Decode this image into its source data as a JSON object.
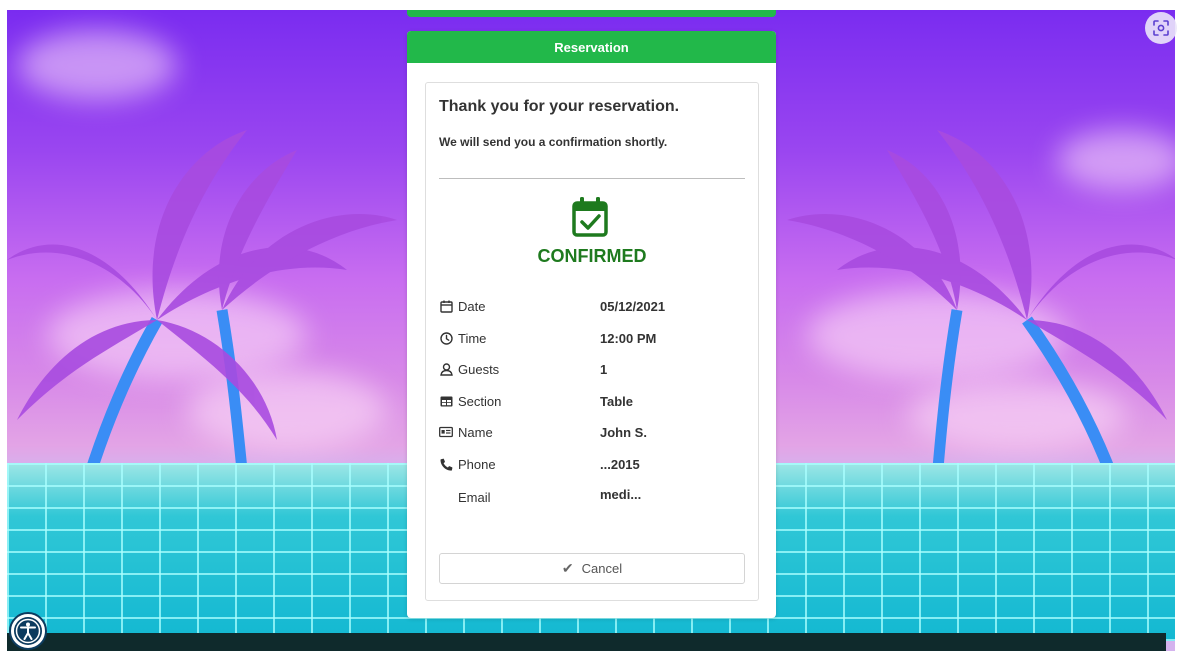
{
  "card": {
    "header_title": "Reservation",
    "thank_you": "Thank you for your reservation.",
    "subtitle": "We will send you a confirmation shortly.",
    "status": "CONFIRMED",
    "status_color": "#1e7a1e",
    "accent_color": "#22b84a"
  },
  "details": [
    {
      "icon": "calendar-icon",
      "label": "Date",
      "value": "05/12/2021"
    },
    {
      "icon": "clock-icon",
      "label": "Time",
      "value": "12:00 PM"
    },
    {
      "icon": "user-icon",
      "label": "Guests",
      "value": "1"
    },
    {
      "icon": "table-icon",
      "label": "Section",
      "value": "Table"
    },
    {
      "icon": "id-card-icon",
      "label": "Name",
      "value": "John S."
    },
    {
      "icon": "phone-icon",
      "label": "Phone",
      "value": "...2015"
    },
    {
      "icon": "",
      "label": "Email",
      "value": "medi..."
    }
  ],
  "actions": {
    "cancel_label": "Cancel"
  }
}
